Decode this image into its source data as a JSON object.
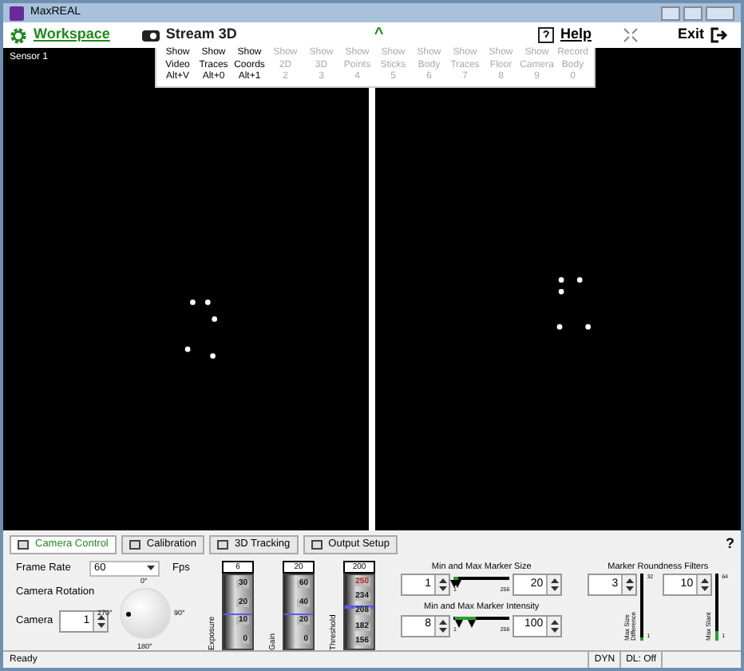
{
  "window": {
    "title": "MaxREAL"
  },
  "toolbar": {
    "workspace": "Workspace",
    "stream": "Stream 3D",
    "collapse": "^",
    "help": "Help",
    "exit": "Exit"
  },
  "display_menu": [
    {
      "lines": [
        "Show",
        "Video",
        "Alt+V"
      ],
      "disabled": false
    },
    {
      "lines": [
        "Show",
        "Traces",
        "Alt+0"
      ],
      "disabled": false
    },
    {
      "lines": [
        "Show",
        "Coords",
        "Alt+1"
      ],
      "disabled": false
    },
    {
      "lines": [
        "Show",
        "2D",
        "2"
      ],
      "disabled": true
    },
    {
      "lines": [
        "Show",
        "3D",
        "3"
      ],
      "disabled": true
    },
    {
      "lines": [
        "Show",
        "Points",
        "4"
      ],
      "disabled": true
    },
    {
      "lines": [
        "Show",
        "Sticks",
        "5"
      ],
      "disabled": true
    },
    {
      "lines": [
        "Show",
        "Body",
        "6"
      ],
      "disabled": true
    },
    {
      "lines": [
        "Show",
        "Traces",
        "7"
      ],
      "disabled": true
    },
    {
      "lines": [
        "Show",
        "Floor",
        "8"
      ],
      "disabled": true
    },
    {
      "lines": [
        "Show",
        "Camera",
        "9"
      ],
      "disabled": true
    },
    {
      "lines": [
        "Record",
        "Body",
        "0"
      ],
      "disabled": true
    }
  ],
  "left_viewport": {
    "label": "Sensor 1"
  },
  "tabs": [
    {
      "label": "Camera Control",
      "selected": true
    },
    {
      "label": "Calibration",
      "selected": false
    },
    {
      "label": "3D Tracking",
      "selected": false
    },
    {
      "label": "Output Setup",
      "selected": false
    }
  ],
  "help_mark": "?",
  "camera": {
    "frame_rate_label": "Frame Rate",
    "frame_rate": "60",
    "fps": "Fps",
    "rotation_label": "Camera Rotation",
    "camera_label": "Camera",
    "camera": "1",
    "dial": [
      "0°",
      "270°",
      "90°",
      "180°"
    ]
  },
  "vsliders": [
    {
      "name": "Exposure",
      "value": "6",
      "ticks": [
        {
          "t": "30",
          "warn": false
        },
        {
          "t": "20",
          "warn": false
        },
        {
          "t": "10",
          "warn": false
        },
        {
          "t": "0",
          "warn": false
        }
      ],
      "level": 0.45
    },
    {
      "name": "Gain",
      "value": "20",
      "ticks": [
        {
          "t": "60",
          "warn": false
        },
        {
          "t": "40",
          "warn": false
        },
        {
          "t": "20",
          "warn": false
        },
        {
          "t": "0",
          "warn": false
        }
      ],
      "level": 0.45
    },
    {
      "name": "Threshold",
      "value": "200",
      "ticks": [
        {
          "t": "250",
          "warn": true
        },
        {
          "t": "234",
          "warn": false
        },
        {
          "t": "208",
          "warn": false
        },
        {
          "t": "182",
          "warn": false
        },
        {
          "t": "156",
          "warn": false
        }
      ],
      "level": 0.55
    }
  ],
  "range_sliders": [
    {
      "title": "Min and Max Marker Size",
      "min": "1",
      "max": "20",
      "scale_min": "1",
      "scale_max": "256"
    },
    {
      "title": "Min and Max Marker Intensity",
      "min": "8",
      "max": "100",
      "scale_min": "1",
      "scale_max": "256"
    }
  ],
  "roundness": {
    "title": "Marker Roundness Filters",
    "filters": [
      {
        "name": "Max Size Difference",
        "value": "3",
        "scale_max": "32",
        "scale_min": "1",
        "level": 0.06
      },
      {
        "name": "Max Slant",
        "value": "10",
        "scale_max": "64",
        "scale_min": "1",
        "level": 0.14
      }
    ]
  },
  "status_bar": {
    "text": "Ready",
    "panes": [
      "DYN",
      "DL: Off"
    ]
  }
}
